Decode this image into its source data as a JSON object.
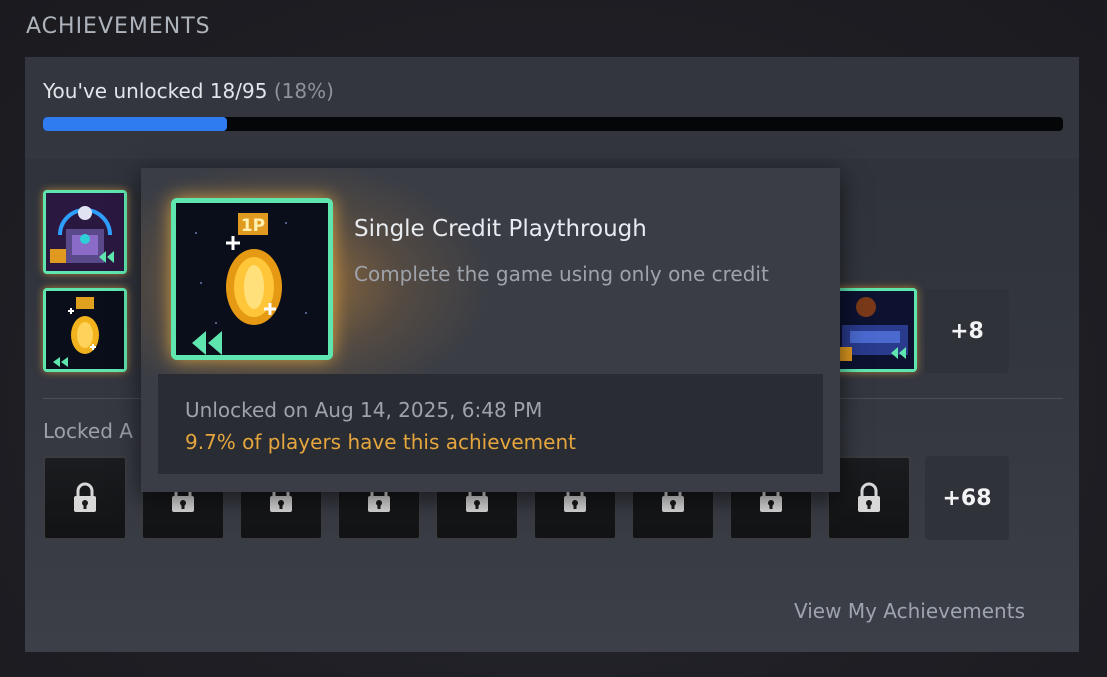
{
  "section_title": "ACHIEVEMENTS",
  "progress": {
    "label": "You've unlocked 18/95",
    "percent_label": "(18%)",
    "fraction": 0.18
  },
  "unlocked_more": "+8",
  "locked_label": "Locked A",
  "locked_more": "+68",
  "view_link": "View My Achievements",
  "tooltip": {
    "name": "Single Credit Playthrough",
    "description": "Complete the game using only one credit",
    "icon_badge": "1P",
    "unlocked_date": "Unlocked on Aug 14, 2025, 6:48 PM",
    "rarity": "9.7% of players have this achievement"
  },
  "tile_badge": "1P",
  "colors": {
    "accent_blue": "#2f7bf0",
    "rarity_gold": "#e5a63d",
    "tile_border": "#5fe6ae"
  }
}
